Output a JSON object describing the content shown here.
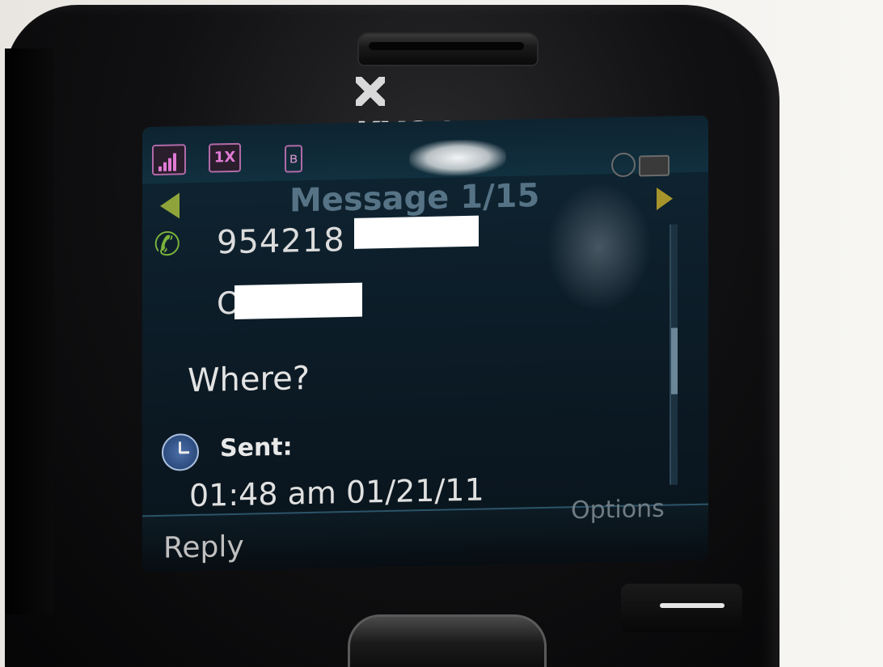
{
  "device": {
    "brand": "KYOCERA"
  },
  "status_bar": {
    "network_label": "1X",
    "bluetooth_symbol": "ʙ"
  },
  "header": {
    "title": "Message 1/15"
  },
  "message": {
    "contact_number_visible": "954218",
    "contact_name_initial": "O",
    "body": "Where?",
    "sent_label": "Sent:",
    "sent_time": "01:48 am 01/21/11"
  },
  "softkeys": {
    "left": "Reply",
    "right": "Options"
  },
  "icons": {
    "signal": "signal-strength-icon",
    "network": "1x-network-icon",
    "bluetooth": "bluetooth-icon",
    "alarm": "alarm-icon",
    "battery": "battery-icon",
    "phone": "phone-handset-icon",
    "clock": "clock-icon",
    "nav_prev": "arrow-left-icon",
    "nav_next": "arrow-right-icon"
  },
  "colors": {
    "screen_bg": "#0d1f2b",
    "accent_green": "#7bb33c",
    "status_icon_magenta": "#e07ad4"
  }
}
